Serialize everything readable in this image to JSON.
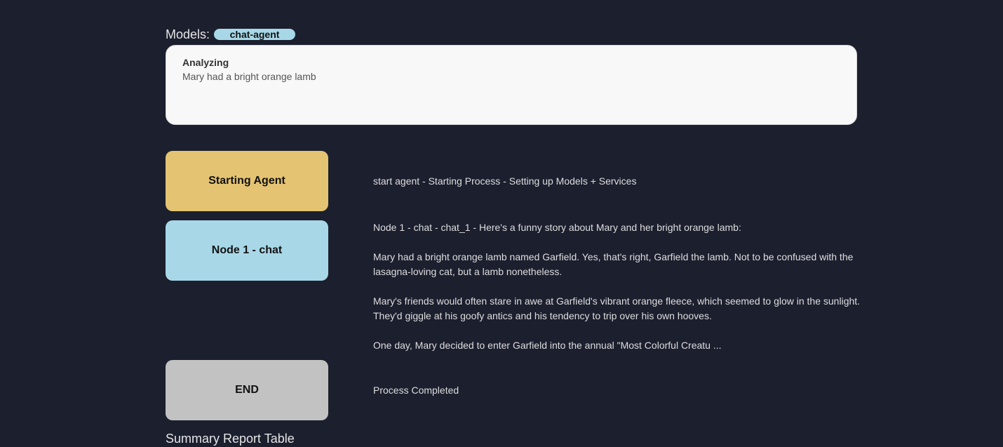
{
  "models": {
    "label": "Models:",
    "badge": "chat-agent"
  },
  "input": {
    "title": "Analyzing",
    "text": "Mary had a bright orange lamb"
  },
  "nodes": [
    {
      "label": "Starting Agent",
      "color": "#e4c472"
    },
    {
      "label": "Node 1 - chat",
      "color": "#a8d8e8"
    },
    {
      "label": "END",
      "color": "#c2c2c2"
    }
  ],
  "messages": {
    "start": "start agent - Starting Process - Setting up Models + Services",
    "chat": [
      "Node 1 - chat - chat_1 - Here's a funny story about Mary and her bright orange lamb:",
      "Mary had a bright orange lamb named Garfield. Yes, that's right, Garfield the lamb. Not to be confused with the lasagna-loving cat, but a lamb nonetheless.",
      "Mary's friends would often stare in awe at Garfield's vibrant orange fleece, which seemed to glow in the sunlight. They'd giggle at his goofy antics and his tendency to trip over his own hooves.",
      "One day, Mary decided to enter Garfield into the annual \"Most Colorful Creatu ..."
    ],
    "end": "Process Completed"
  },
  "summary": {
    "title": "Summary Report Table"
  }
}
